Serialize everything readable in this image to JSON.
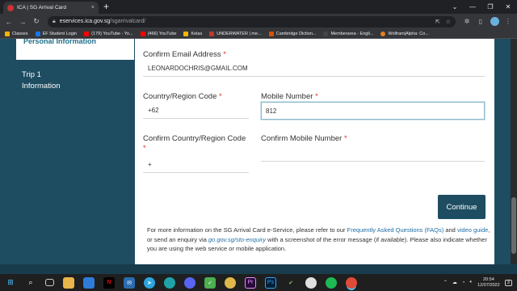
{
  "browser": {
    "tab_title": "ICA | SG Arrival Card",
    "tab_close": "×",
    "new_tab": "+",
    "url_host": "eservices.ica.gov.sg",
    "url_path": "/sgarrivalcard/",
    "bookmarks": [
      {
        "label": "Classes",
        "color": "#f4b400"
      },
      {
        "label": "EF Student Login",
        "color": "#1a73e8"
      },
      {
        "label": "(179) YouTube - Yo...",
        "color": "#ff0000"
      },
      {
        "label": "(466) YouTube",
        "color": "#ff0000"
      },
      {
        "label": "Kelas",
        "color": "#f4b400"
      },
      {
        "label": "UNDERWATER | me...",
        "color": "#c0392b"
      },
      {
        "label": "Cambridge Diction...",
        "color": "#d35400"
      },
      {
        "label": "Memberarea - Engli...",
        "color": "#444444"
      },
      {
        "label": "Wolfram|Alpha: Co...",
        "color": "#e67e22"
      }
    ]
  },
  "sidebar": {
    "active_tab": "Personal Information",
    "trip_line1": "Trip 1",
    "trip_line2": "Information"
  },
  "form": {
    "confirm_email_label": "Confirm Email Address",
    "confirm_email_value": "LEONARDOCHRIS@GMAIL.COM",
    "country_code_label": "Country/Region Code",
    "country_code_value": "+62",
    "mobile_label": "Mobile Number",
    "mobile_value": "812",
    "confirm_country_label": "Confirm Country/Region Code",
    "confirm_country_value": "+",
    "confirm_mobile_label": "Confirm Mobile Number",
    "confirm_mobile_value": "",
    "required_marker": "*",
    "continue_label": "Continue"
  },
  "info": {
    "t1": "For more information on the SG Arrival Card e-Service, please refer to our ",
    "faq_link": "Frequently Asked Questions (FAQs)",
    "t2": " and ",
    "video_link": "video guide",
    "t3": ", or send an enquiry via ",
    "enquiry_link": "go.gov.sg/sto-enquiry",
    "t4": " with a screenshot of the error message (if available). Please also indicate whether you are using the web service or mobile application."
  },
  "taskbar": {
    "time": "20:54",
    "date": "12/07/2022",
    "notifications": "3"
  },
  "colors": {
    "brand": "#1e4d61",
    "link": "#1f6ea6",
    "required": "#d9322c"
  }
}
